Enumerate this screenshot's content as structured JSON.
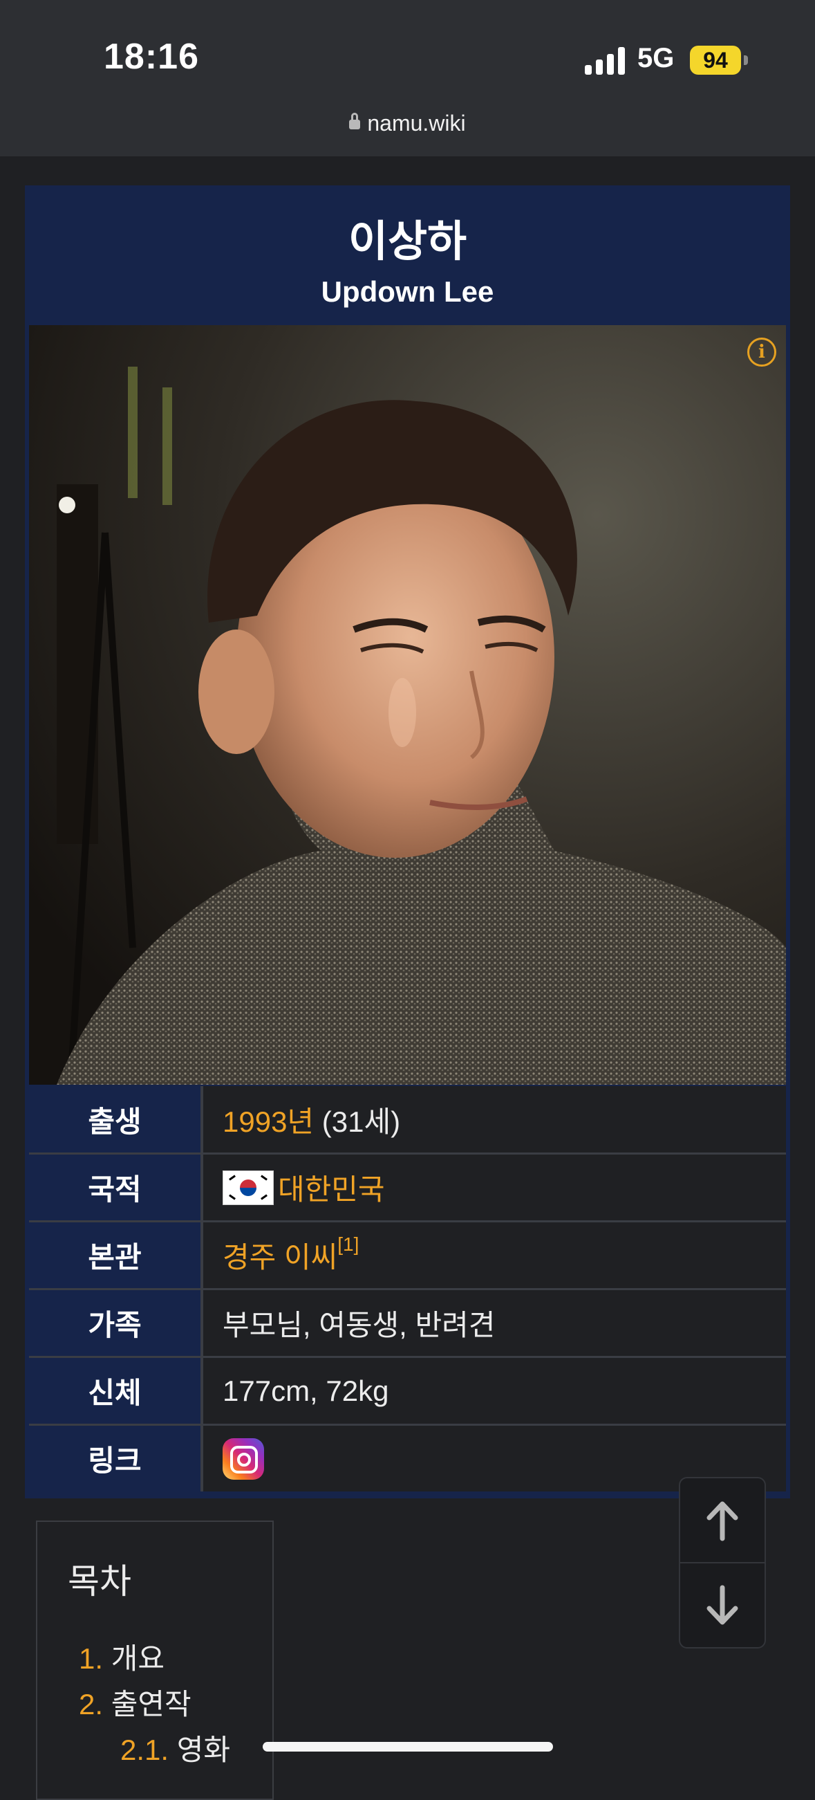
{
  "status_bar": {
    "time": "18:16",
    "network": "5G",
    "battery": "94"
  },
  "browser": {
    "url": "namu.wiki"
  },
  "profile": {
    "name_ko": "이상하",
    "name_en": "Updown Lee",
    "rows": [
      {
        "label": "출생",
        "value_link": "1993년",
        "value_text": " (31세)"
      },
      {
        "label": "국적",
        "value_link": "대한민국"
      },
      {
        "label": "본관",
        "value_link": "경주 이씨",
        "footnote": "[1]"
      },
      {
        "label": "가족",
        "value_text": "부모님, 여동생, 반려견"
      },
      {
        "label": "신체",
        "value_text": "177cm, 72kg"
      },
      {
        "label": "링크",
        "icon": "instagram-icon"
      }
    ]
  },
  "toc": {
    "title": "목차",
    "items": [
      {
        "num": "1.",
        "label": "개요"
      },
      {
        "num": "2.",
        "label": "출연작"
      },
      {
        "num": "2.1.",
        "label": "영화"
      }
    ]
  },
  "colors": {
    "accent": "#f0a326",
    "header_bg": "#16244a",
    "page_bg": "#1f2023"
  }
}
